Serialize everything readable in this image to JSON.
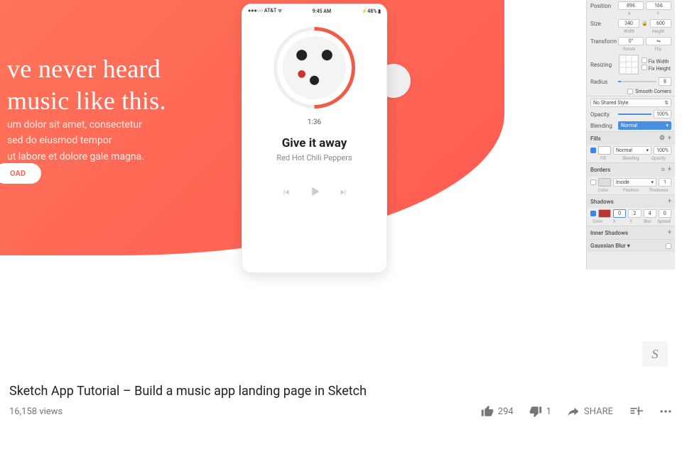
{
  "video": {
    "title": "Sketch App Tutorial – Build a music app landing page in Sketch",
    "views": "16,158 views",
    "likes": "294",
    "dislikes": "1",
    "share_label": "SHARE",
    "watermark": "S"
  },
  "landing": {
    "headline_l1": "ve never heard",
    "headline_l2": "music like this.",
    "body_l1": "um dolor sit amet, consectetur",
    "body_l2": "sed do eiusmod tempor",
    "body_l3": "ut labore et dolore gale magna.",
    "cta": "OAD"
  },
  "phone": {
    "carrier": "●●●○○ AT&T ᯤ",
    "clock": "9:45 AM",
    "battery": "⚡48% ▮",
    "timecode": "1:36",
    "track_title": "Give it away",
    "track_artist": "Red Hot Chili Peppers"
  },
  "inspector": {
    "position_label": "Position",
    "position_x": "896",
    "position_y": "166",
    "x_label": "X",
    "y_label": "Y",
    "size_label": "Size",
    "size_w": "340",
    "size_h": "600",
    "w_label": "Width",
    "h_label": "Height",
    "lock_icon": "🔒",
    "transform_label": "Transform",
    "transform_deg": "0°",
    "flip": "⇋",
    "rotate_label": "Rotate",
    "flip_label": "Flip",
    "resizing_label": "Resizing",
    "fix_width": "Fix Width",
    "fix_height": "Fix Height",
    "radius_label": "Radius",
    "radius_val": "8",
    "smooth_corners": "Smooth Corners",
    "shared_style": "No Shared Style",
    "opacity_label": "Opacity",
    "opacity_val": "100%",
    "blending_label": "Blending",
    "blending_mode": "Normal",
    "fills_label": "Fills",
    "fill_mode": "Normal",
    "fill_opacity": "100%",
    "fill_sub": "Fill",
    "blending_sub": "Blending",
    "opacity_sub": "Opacity",
    "borders_label": "Borders",
    "border_position": "Inside",
    "border_thickness": "1",
    "color_sub": "Color",
    "position_sub": "Position",
    "thickness_sub": "Thickness",
    "shadows_label": "Shadows",
    "shadow_x": "0",
    "shadow_y": "2",
    "shadow_blur": "4",
    "shadow_spread": "0",
    "blur_sub": "Blur",
    "spread_sub": "Spread",
    "inner_shadows_label": "Inner Shadows",
    "gaussian_blur_label": "Gaussian Blur"
  }
}
